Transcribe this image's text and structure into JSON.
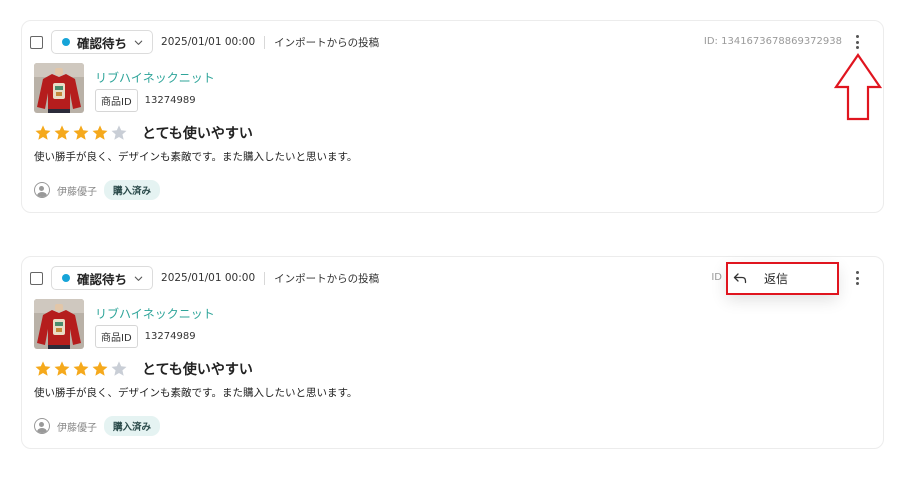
{
  "reviews": [
    {
      "status": "確認待ち",
      "date": "2025/01/01 00:00",
      "source": "インポートからの投稿",
      "id_text": "ID: 1341673678869372938",
      "product_name": "リブハイネックニット",
      "product_id_label": "商品ID",
      "product_id": "13274989",
      "rating": 4,
      "rating_max": 5,
      "title": "とても使いやすい",
      "body": "使い勝手が良く、デザインも素敵です。また購入したいと思います。",
      "user": "伊藤優子",
      "purchase_badge": "購入済み"
    },
    {
      "status": "確認待ち",
      "date": "2025/01/01 00:00",
      "source": "インポートからの投稿",
      "id_text": "ID",
      "product_name": "リブハイネックニット",
      "product_id_label": "商品ID",
      "product_id": "13274989",
      "rating": 4,
      "rating_max": 5,
      "title": "とても使いやすい",
      "body": "使い勝手が良く、デザインも素敵です。また購入したいと思います。",
      "user": "伊藤優子",
      "purchase_badge": "購入済み"
    }
  ],
  "popup_menu": {
    "reply_label": "返信",
    "reply_icon": "reply-arrow-icon"
  },
  "colors": {
    "status_dot": "#16a4d8",
    "product_link": "#2fa59a",
    "star_filled": "#f5a91c",
    "star_empty": "#c9ced6",
    "annotation_red": "#e0151f",
    "purchased_badge_bg": "#e5f3f2"
  },
  "icons": [
    "checkbox",
    "status-dot-icon",
    "chevron-down-icon",
    "more-vertical-icon",
    "star-icon",
    "user-avatar-icon",
    "reply-arrow-icon",
    "up-arrow-annotation-icon"
  ]
}
